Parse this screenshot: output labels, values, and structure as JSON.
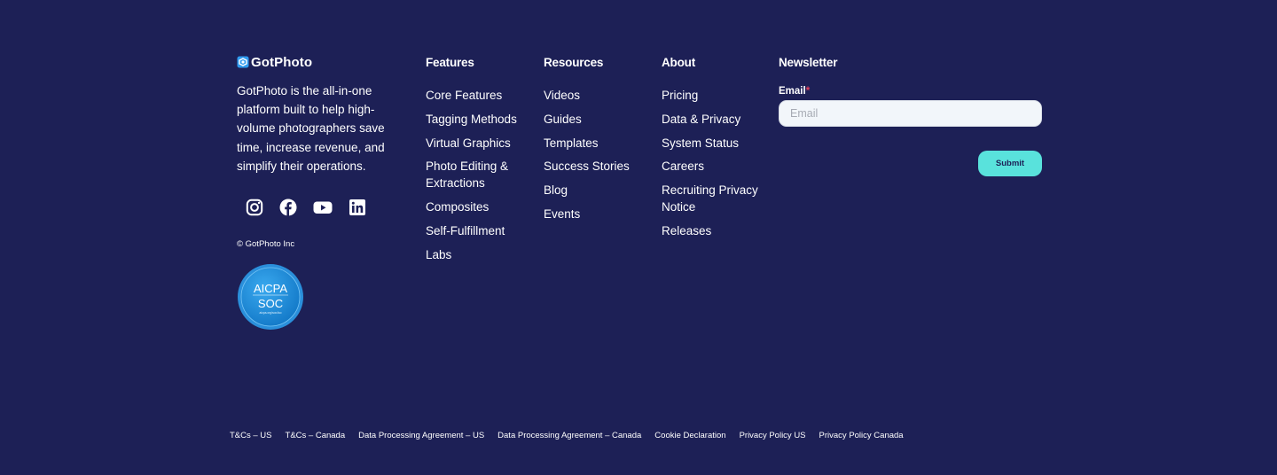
{
  "brand": {
    "logo_text": "GotPhoto",
    "description": "GotPhoto is the all-in-one platform built to help high-volume photographers save time, increase revenue, and simplify their operations.",
    "socials": [
      "instagram-icon",
      "facebook-icon",
      "youtube-icon",
      "linkedin-icon"
    ],
    "copyright": "© GotPhoto Inc",
    "badge": {
      "line1": "AICPA",
      "line2": "SOC",
      "small": "aicpa.org/soc4so"
    }
  },
  "columns": [
    {
      "title": "Features",
      "links": [
        "Core Features",
        "Tagging Methods",
        "Virtual Graphics",
        "Photo Editing & Extractions",
        "Composites",
        "Self-Fulfillment",
        "Labs"
      ]
    },
    {
      "title": "Resources",
      "links": [
        "Videos",
        "Guides",
        "Templates",
        "Success Stories",
        "Blog",
        "Events"
      ]
    },
    {
      "title": "About",
      "links": [
        "Pricing",
        "Data & Privacy",
        "System Status",
        "Careers",
        "Recruiting Privacy Notice",
        "Releases"
      ]
    }
  ],
  "newsletter": {
    "title": "Newsletter",
    "email_label": "Email",
    "required_mark": "*",
    "email_placeholder": "Email",
    "submit_label": "Submit"
  },
  "legal": [
    "T&Cs – US",
    "T&Cs – Canada",
    "Data Processing Agreement – US",
    "Data Processing Agreement – Canada",
    "Cookie Declaration",
    "Privacy Policy US",
    "Privacy Policy Canada"
  ],
  "colors": {
    "background": "#1d2056",
    "accent": "#59e2dc",
    "logo_blue": "#2f9bf0",
    "required": "#e2405a"
  }
}
